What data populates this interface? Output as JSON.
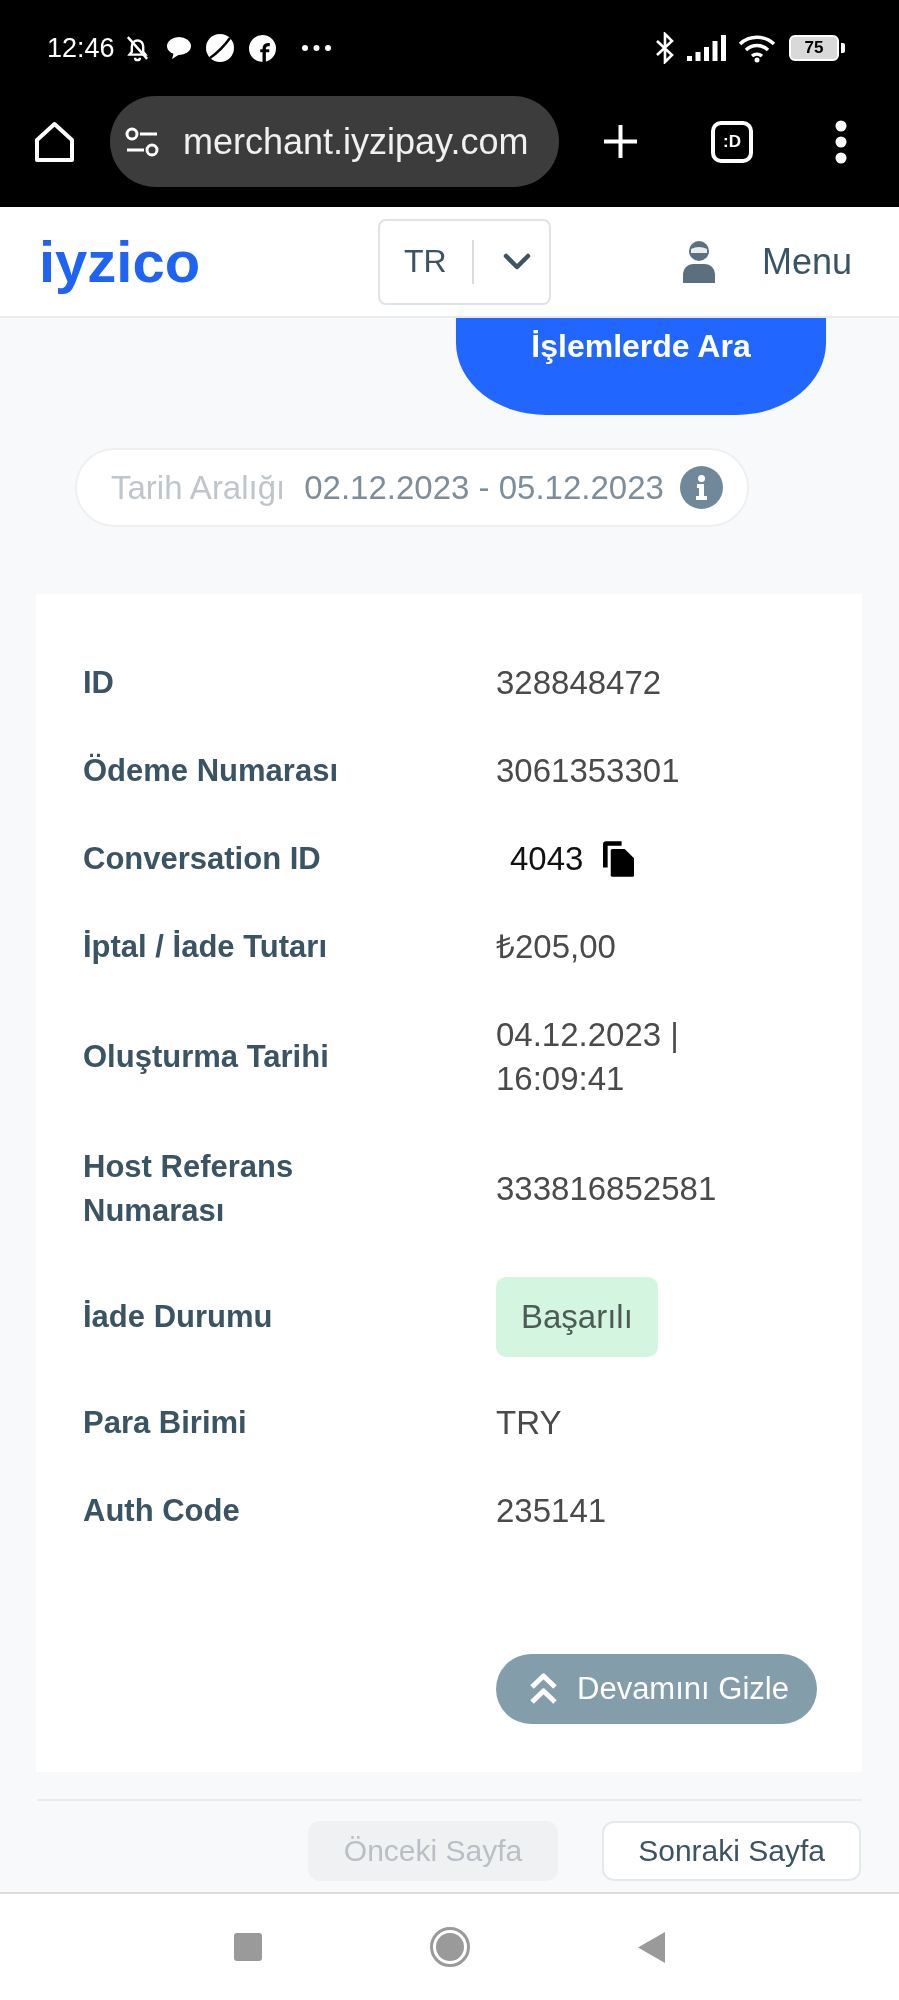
{
  "status_bar": {
    "time": "12:46",
    "battery": "75"
  },
  "browser": {
    "url": "merchant.iyzipay.com",
    "tab_switcher": ":D"
  },
  "header": {
    "logo": "iyzico",
    "language": "TR",
    "menu": "Menu"
  },
  "search_button": "İşlemlerde Ara",
  "date_range": {
    "label": "Tarih Aralığı",
    "value": "02.12.2023 - 05.12.2023"
  },
  "details": [
    {
      "kind": "text",
      "label": "ID",
      "value": "328848472"
    },
    {
      "kind": "text",
      "label": "Ödeme Numarası",
      "value": "3061353301"
    },
    {
      "kind": "copy",
      "label": "Conversation ID",
      "value": "4043"
    },
    {
      "kind": "text",
      "label": "İptal / İade Tutarı",
      "value": "₺205,00"
    },
    {
      "kind": "text",
      "label": "Oluşturma Tarihi",
      "value": "04.12.2023 | 16:09:41"
    },
    {
      "kind": "text",
      "label": "Host Referans Numarası",
      "value": "333816852581"
    },
    {
      "kind": "badge",
      "label": "İade Durumu",
      "value": "Başarılı"
    },
    {
      "kind": "text",
      "label": "Para Birimi",
      "value": "TRY"
    },
    {
      "kind": "text",
      "label": "Auth Code",
      "value": "235141"
    }
  ],
  "collapse_button": "Devamını Gizle",
  "pagination": [
    {
      "label": "Önceki Sayfa",
      "disabled": true
    },
    {
      "label": "Sonraki Sayfa",
      "disabled": false
    }
  ]
}
